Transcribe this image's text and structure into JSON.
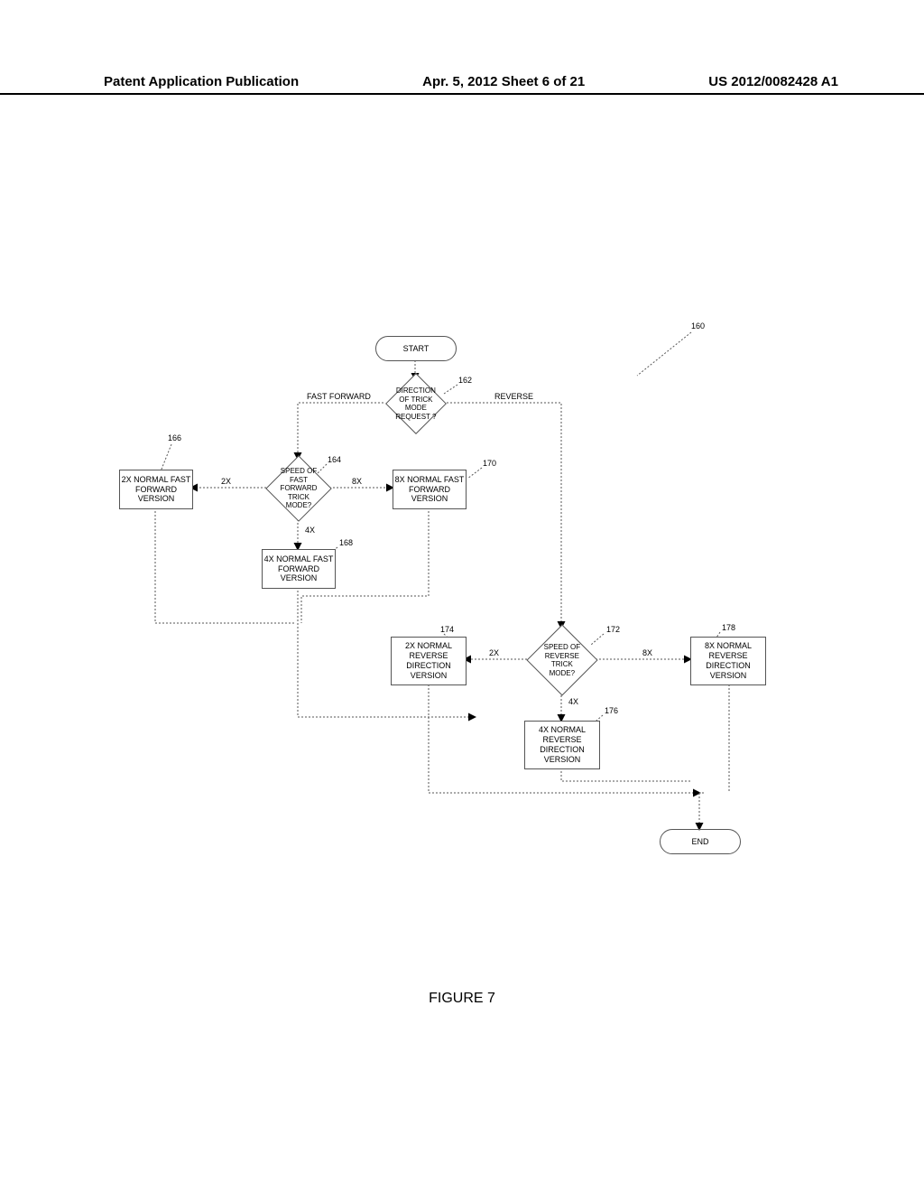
{
  "header": {
    "left": "Patent Application Publication",
    "center": "Apr. 5, 2012  Sheet 6 of 21",
    "right": "US 2012/0082428 A1"
  },
  "caption": "FIGURE 7",
  "nodes": {
    "start": "START",
    "end": "END",
    "q_dir": "DIRECTION OF TRICK MODE REQUEST ?",
    "q_ff": "SPEED OF FAST FORWARD TRICK MODE?",
    "q_rv": "SPEED OF REVERSE TRICK MODE?",
    "ff2": "2X NORMAL FAST FORWARD VERSION",
    "ff4": "4X NORMAL FAST FORWARD VERSION",
    "ff8": "8X NORMAL FAST FORWARD VERSION",
    "rv2": "2X NORMAL REVERSE DIRECTION VERSION",
    "rv4": "4X NORMAL REVERSE DIRECTION VERSION",
    "rv8": "8X NORMAL REVERSE DIRECTION VERSION"
  },
  "edges": {
    "fast_forward": "FAST FORWARD",
    "reverse": "REVERSE",
    "x2": "2X",
    "x4": "4X",
    "x8": "8X"
  },
  "refs": {
    "r160": "160",
    "r162": "162",
    "r164": "164",
    "r166": "166",
    "r168": "168",
    "r170": "170",
    "r172": "172",
    "r174": "174",
    "r176": "176",
    "r178": "178"
  }
}
